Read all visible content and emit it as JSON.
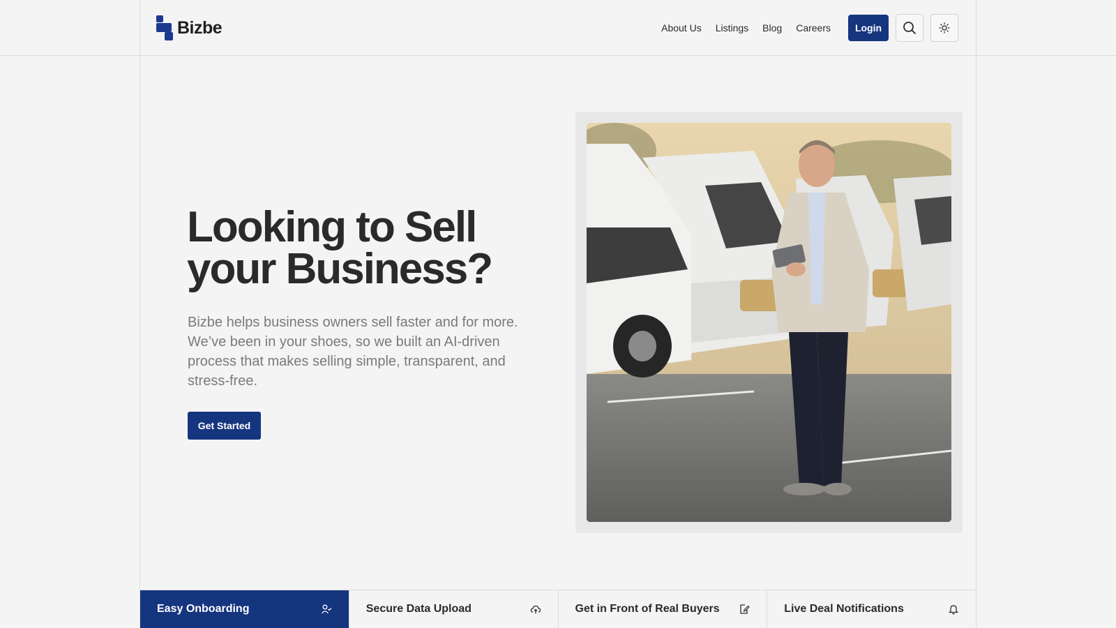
{
  "brand": {
    "name": "Bizbe",
    "color": "#16357f"
  },
  "nav": {
    "links": [
      "About Us",
      "Listings",
      "Blog",
      "Careers"
    ],
    "login_label": "Login",
    "search_icon": "search-icon",
    "theme_icon": "sun-icon"
  },
  "hero": {
    "title_line1": "Looking to Sell",
    "title_line2": "your Business?",
    "description": "Bizbe helps business owners sell faster and for more. We’ve been in your shoes, so we built an AI-driven process that makes selling simple, transparent, and stress-free.",
    "cta_label": "Get Started"
  },
  "features": [
    {
      "label": "Easy Onboarding",
      "icon": "user-check-icon",
      "active": true
    },
    {
      "label": "Secure Data Upload",
      "icon": "cloud-upload-icon",
      "active": false
    },
    {
      "label": "Get in Front of Real Buyers",
      "icon": "edit-document-icon",
      "active": false
    },
    {
      "label": "Live Deal Notifications",
      "icon": "bell-icon",
      "active": false
    }
  ]
}
